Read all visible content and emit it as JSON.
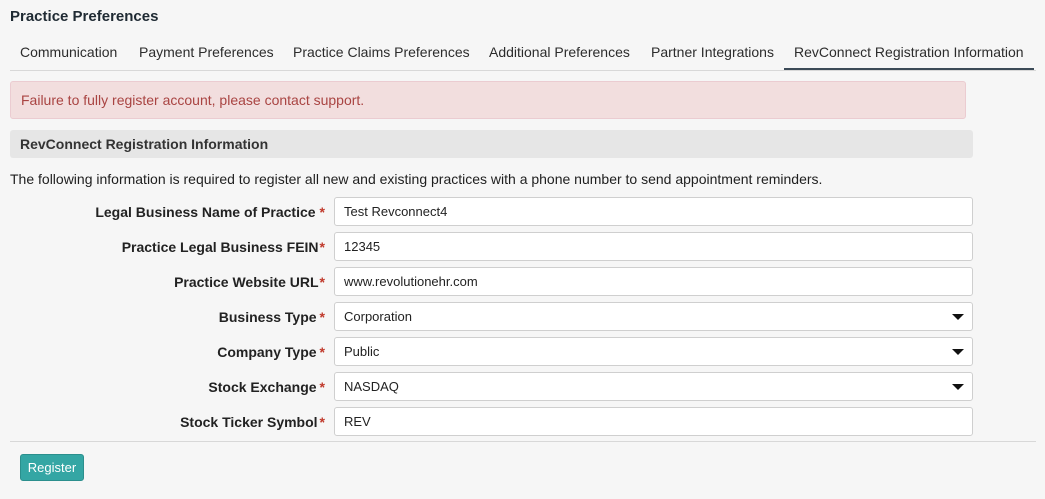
{
  "page": {
    "title": "Practice Preferences"
  },
  "tabs": [
    {
      "label": "Communication"
    },
    {
      "label": "Payment Preferences"
    },
    {
      "label": "Practice Claims Preferences"
    },
    {
      "label": "Additional Preferences"
    },
    {
      "label": "Partner Integrations"
    },
    {
      "label": "RevConnect Registration Information",
      "active": true
    }
  ],
  "alert": {
    "text": "Failure to fully register account, please contact support.",
    "color": "#a94442"
  },
  "section": {
    "title": "RevConnect Registration Information",
    "intro": "The following information is required to register all new and existing practices with a phone number to send appointment reminders."
  },
  "form": {
    "legal_name": {
      "label": "Legal Business Name of Practice",
      "value": "Test Revconnect4"
    },
    "fein": {
      "label": "Practice Legal Business FEIN",
      "value": "12345"
    },
    "website": {
      "label": "Practice Website URL",
      "value": "www.revolutionehr.com"
    },
    "business_type": {
      "label": "Business Type",
      "value": "Corporation"
    },
    "company_type": {
      "label": "Company Type",
      "value": "Public"
    },
    "stock_exchange": {
      "label": "Stock Exchange",
      "value": "NASDAQ"
    },
    "ticker": {
      "label": "Stock Ticker Symbol",
      "value": "REV"
    },
    "required_mark": "*"
  },
  "actions": {
    "register_label": "Register",
    "button_color": "#34a6a4"
  }
}
